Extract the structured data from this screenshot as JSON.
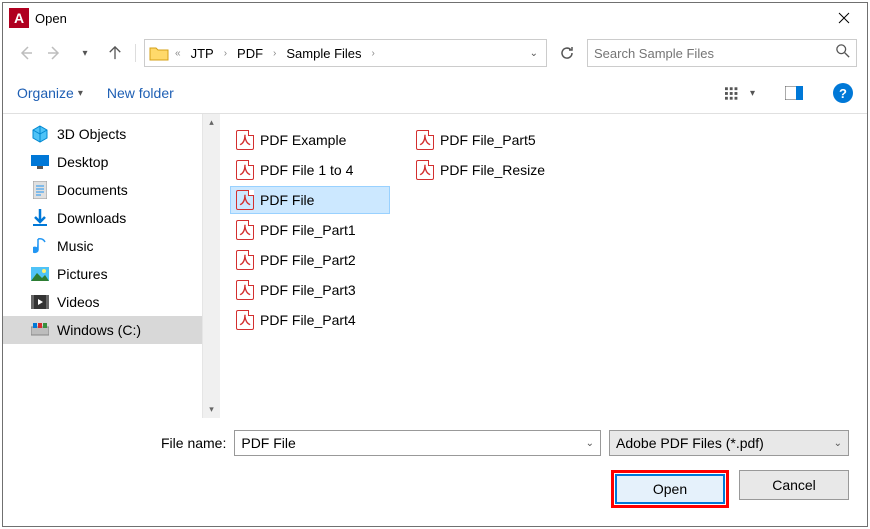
{
  "title": "Open",
  "breadcrumbs": {
    "prefix": "«",
    "items": [
      "JTP",
      "PDF",
      "Sample Files"
    ]
  },
  "search": {
    "placeholder": "Search Sample Files"
  },
  "toolbar": {
    "organize": "Organize",
    "new_folder": "New folder"
  },
  "tree": {
    "items": [
      {
        "label": "3D Objects",
        "icon": "3d"
      },
      {
        "label": "Desktop",
        "icon": "desktop"
      },
      {
        "label": "Documents",
        "icon": "documents"
      },
      {
        "label": "Downloads",
        "icon": "downloads"
      },
      {
        "label": "Music",
        "icon": "music"
      },
      {
        "label": "Pictures",
        "icon": "pictures"
      },
      {
        "label": "Videos",
        "icon": "videos"
      },
      {
        "label": "Windows (C:)",
        "icon": "drive",
        "selected": true
      }
    ]
  },
  "files": {
    "items": [
      {
        "label": "PDF Example"
      },
      {
        "label": "PDF File 1 to 4"
      },
      {
        "label": "PDF File",
        "selected": true
      },
      {
        "label": "PDF File_Part1"
      },
      {
        "label": "PDF File_Part2"
      },
      {
        "label": "PDF File_Part3"
      },
      {
        "label": "PDF File_Part4"
      },
      {
        "label": "PDF File_Part5"
      },
      {
        "label": "PDF File_Resize"
      }
    ]
  },
  "footer": {
    "filename_label": "File name:",
    "filename_value": "PDF File",
    "filetype_value": "Adobe PDF Files (*.pdf)",
    "open": "Open",
    "cancel": "Cancel"
  }
}
